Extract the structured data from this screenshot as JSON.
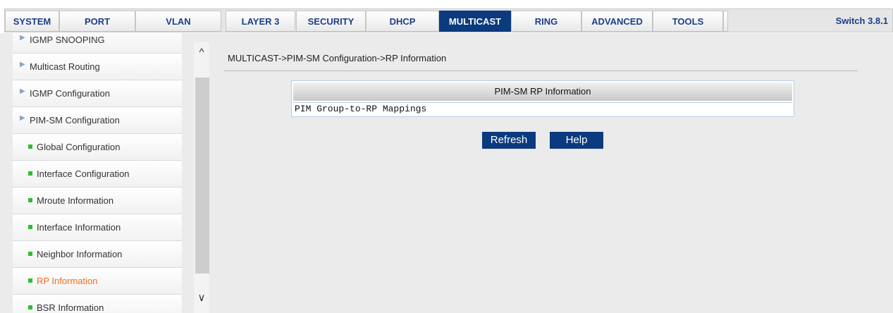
{
  "nav": {
    "tabs": [
      "SYSTEM",
      "PORT",
      "VLAN",
      "LAYER 3",
      "SECURITY",
      "DHCP",
      "MULTICAST",
      "RING",
      "ADVANCED",
      "TOOLS"
    ],
    "active_tab": "MULTICAST",
    "version": "Switch 3.8.1"
  },
  "sidebar": {
    "items": [
      {
        "label": "IGMP SNOOPING"
      },
      {
        "label": "Multicast Routing"
      },
      {
        "label": "IGMP Configuration"
      },
      {
        "label": "PIM-SM Configuration"
      },
      {
        "label": "Global Configuration"
      },
      {
        "label": "Interface Configuration"
      },
      {
        "label": "Mroute Information"
      },
      {
        "label": "Interface Information"
      },
      {
        "label": "Neighbor Information"
      },
      {
        "label": "RP Information"
      },
      {
        "label": "BSR Information"
      }
    ],
    "active_item": "RP Information",
    "scroll_up_glyph": "^",
    "scroll_down_glyph": "∨"
  },
  "main": {
    "breadcrumb": "MULTICAST->PIM-SM Configuration->RP Information",
    "table": {
      "header": "PIM-SM RP Information",
      "row": "PIM Group-to-RP Mappings"
    },
    "buttons": {
      "refresh": "Refresh",
      "help": "Help"
    }
  },
  "colors": {
    "nav_active_bg": "#0b3a7e",
    "nav_text": "#1d3f88",
    "active_item_text": "#f26d21",
    "sub_item_bullet": "#35b935",
    "button_bg": "#0b3a7e"
  }
}
